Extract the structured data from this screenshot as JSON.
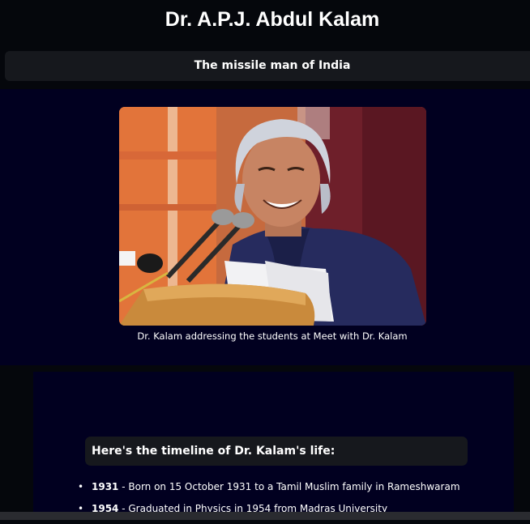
{
  "page": {
    "title": "Dr. A.P.J. Abdul Kalam",
    "subtitle": "The missile man of India"
  },
  "hero": {
    "image_description": "Photo of Dr. Kalam smiling, speaking at a podium with microphones",
    "caption": "Dr. Kalam addressing the students at Meet with Dr. Kalam"
  },
  "timeline": {
    "heading": "Here's the timeline of Dr. Kalam's life:",
    "items": [
      {
        "year": "1931",
        "text": " - Born on 15 October 1931 to a Tamil Muslim family in Rameshwaram"
      },
      {
        "year": "1954",
        "text": " - Graduated in Physics in 1954 from Madras University"
      }
    ]
  },
  "colors": {
    "page_bg": "#05070c",
    "panel_bg": "#010020",
    "bar_bg": "#16181d",
    "text": "#ffffff"
  }
}
